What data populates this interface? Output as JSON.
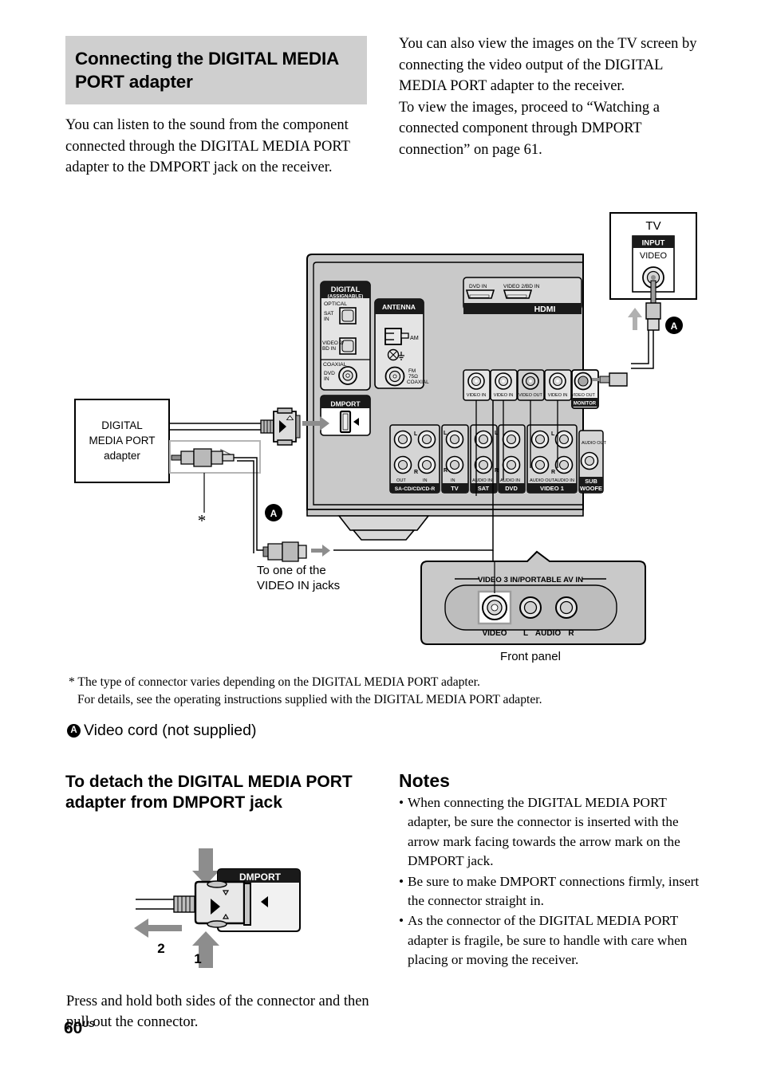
{
  "page": {
    "number": "60",
    "region": "US"
  },
  "left_column": {
    "section_heading": "Connecting the DIGITAL MEDIA PORT adapter",
    "intro": "You can listen to the sound from the component connected through the DIGITAL MEDIA PORT adapter to the DMPORT jack on the receiver."
  },
  "right_column": {
    "para1": "You can also view the images on the TV screen by connecting the video output of the DIGITAL MEDIA PORT adapter to the receiver.",
    "para2": "To view the images, proceed to “Watching a connected component through DMPORT connection” on page 61."
  },
  "footnote": {
    "marker": "*",
    "line1": "The type of connector varies depending on the DIGITAL MEDIA PORT adapter.",
    "line2": "For details, see the operating instructions supplied with the DIGITAL MEDIA PORT adapter."
  },
  "legend": {
    "marker": "A",
    "text": "Video cord (not supplied)"
  },
  "detach": {
    "heading": "To detach the DIGITAL MEDIA PORT adapter from DMPORT jack",
    "jack_label": "DMPORT",
    "step1": "1",
    "step2": "2",
    "instruction": "Press and hold both sides of the connector and then pull out the connector."
  },
  "notes": {
    "heading": "Notes",
    "items": [
      "When connecting the DIGITAL MEDIA PORT adapter, be sure the connector is inserted with the arrow mark facing towards the arrow mark on the DMPORT jack.",
      "Be sure to make DMPORT connections firmly, insert the connector straight in.",
      "As the connector of the DIGITAL MEDIA PORT adapter is fragile, be sure to handle with care when placing or moving the receiver."
    ]
  },
  "diagram": {
    "adapter_box": {
      "line1": "DIGITAL",
      "line2": "MEDIA PORT",
      "line3": "adapter"
    },
    "asterisk": "*",
    "marker_a_adapter": "A",
    "marker_a_tv": "A",
    "video_in_label": {
      "line1": "To one of the",
      "line2": "VIDEO IN jacks"
    },
    "tv": {
      "title": "TV",
      "input": "INPUT",
      "video": "VIDEO"
    },
    "front_panel": {
      "caption": "Front panel",
      "group_label": "VIDEO 3 IN/PORTABLE AV IN",
      "video": "VIDEO",
      "audio_l": "L",
      "audio": "AUDIO",
      "audio_r": "R"
    },
    "receiver": {
      "digital": {
        "title": "DIGITAL",
        "subtitle": "(ASSIGNABLE)",
        "optical": "OPTICAL",
        "sat_in_1": "SAT",
        "sat_in_2": "IN",
        "video2_1": "VIDEO 2/",
        "video2_2": "BD IN",
        "coaxial": "COAXIAL",
        "dvd_1": "DVD",
        "dvd_2": "IN"
      },
      "antenna": {
        "title": "ANTENNA",
        "am": "AM",
        "fm_1": "FM",
        "fm_2": "75Ω",
        "fm_3": "COAXIAL"
      },
      "dmport": {
        "title": "DMPORT"
      },
      "hdmi": {
        "title": "HDMI",
        "dvd_in": "DVD IN",
        "video2_bd_in": "VIDEO 2/BD IN"
      },
      "video_jacks": [
        {
          "label": "VIDEO IN"
        },
        {
          "label": "VIDEO IN"
        },
        {
          "label": "VIDEO OUT"
        },
        {
          "label": "VIDEO IN"
        },
        {
          "label": "VIDEO OUT",
          "badge": "MONITOR"
        }
      ],
      "audio_groups": [
        {
          "name": "SA-CD/CD/CD-R",
          "left_top": "L",
          "left_bottom": "R",
          "sub_left": "OUT",
          "sub_right": "IN"
        },
        {
          "name": "TV",
          "left_top": "L",
          "left_bottom": "R",
          "sub_right": "IN"
        },
        {
          "name": "SAT",
          "left_top": "L",
          "left_bottom": "R",
          "sub_right": "AUDIO IN"
        },
        {
          "name": "DVD",
          "sub_right": "AUDIO IN"
        },
        {
          "name": "VIDEO 1",
          "left_top": "L",
          "left_bottom": "R",
          "sub_left": "AUDIO OUT",
          "sub_right": "AUDIO IN"
        },
        {
          "name": "SUB WOOFER",
          "sub_right": "AUDIO OUT"
        }
      ]
    }
  },
  "colors": {
    "heading_bg": "#cfcfcf",
    "panel_grey": "#c9c9c9",
    "panel_light": "#e2e2e2",
    "dark": "#1a1a1a",
    "arrow_grey": "#8d8d8d"
  }
}
